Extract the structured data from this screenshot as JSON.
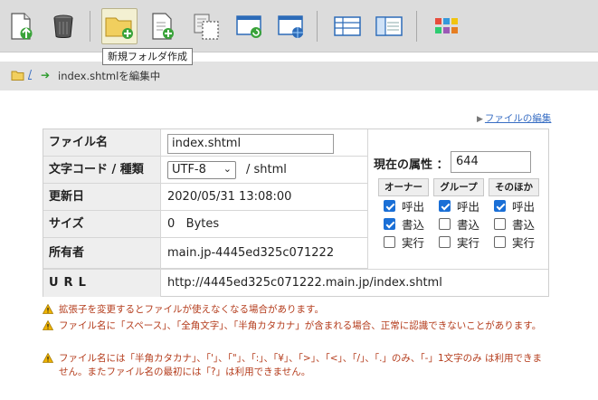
{
  "toolbar": {
    "buttons": [
      {
        "name": "upload-icon"
      },
      {
        "name": "trash-icon"
      },
      {
        "name": "new-folder-icon"
      },
      {
        "name": "new-file-icon"
      },
      {
        "name": "copy-icon"
      },
      {
        "name": "window-refresh-icon"
      },
      {
        "name": "window-globe-icon"
      },
      {
        "name": "list-view-icon"
      },
      {
        "name": "split-view-icon"
      },
      {
        "name": "tiles-view-icon"
      }
    ],
    "tooltip": "新規フォルダ作成"
  },
  "breadcrumb": {
    "root": "/",
    "current": "index.shtmlを編集中"
  },
  "edit_link": "ファイルの編集",
  "file": {
    "name_label": "ファイル名",
    "name_value": "index.shtml",
    "encoding_label": "文字コード / 種類",
    "encoding_value": "UTF-8",
    "type_value": "/ shtml",
    "updated_label": "更新日",
    "updated_value": "2020/05/31 13:08:00",
    "size_label": "サイズ",
    "size_value": "0   Bytes",
    "owner_label": "所有者",
    "owner_value": "main.jp-4445ed325c071222",
    "url_label": "URL",
    "url_value": "http://4445ed325c071222.main.jp/index.shtml"
  },
  "permissions": {
    "label": "現在の属性 ：",
    "value": "644",
    "columns": [
      {
        "header": "オーナー",
        "items": [
          {
            "label": "呼出",
            "checked": true
          },
          {
            "label": "書込",
            "checked": true
          },
          {
            "label": "実行",
            "checked": false
          }
        ]
      },
      {
        "header": "グループ",
        "items": [
          {
            "label": "呼出",
            "checked": true
          },
          {
            "label": "書込",
            "checked": false
          },
          {
            "label": "実行",
            "checked": false
          }
        ]
      },
      {
        "header": "そのほか",
        "items": [
          {
            "label": "呼出",
            "checked": true
          },
          {
            "label": "書込",
            "checked": false
          },
          {
            "label": "実行",
            "checked": false
          }
        ]
      }
    ]
  },
  "notes": [
    "拡張子を変更するとファイルが使えなくなる場合があります。",
    "ファイル名に「スペース」、「全角文字」、「半角カタカナ」が含まれる場合、正常に認識できないことがあります。",
    "ファイル名には「半角カタカナ」、「'」、「\"」、「:」、「¥」、「>」、「<」、「/」、「.」のみ、「-」1文字のみ は利用できません。またファイル名の最初には「?」は利用できません。"
  ],
  "colors": {
    "accent": "#1a6fd6",
    "link": "#3a6fc4",
    "warning_text": "#b43c1c"
  }
}
